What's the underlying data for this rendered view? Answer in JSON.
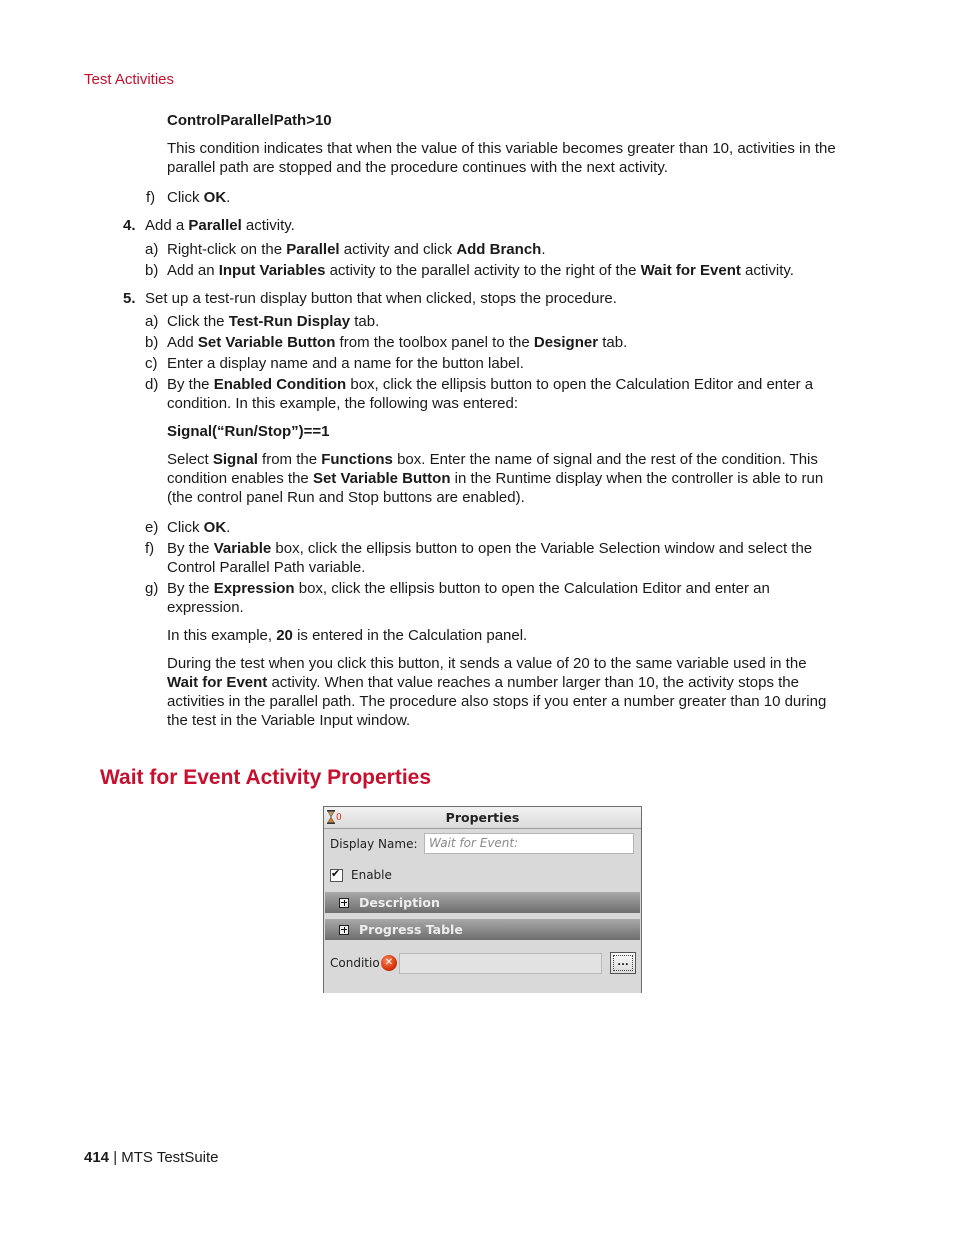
{
  "running_head": "Test Activities",
  "steps": {
    "condition_code": "ControlParallelPath>10",
    "condition_desc": "This condition indicates that when the value of this variable becomes greater than 10, activities in the parallel path are stopped and the procedure continues with the next activity.",
    "step3f": {
      "marker": "f)",
      "pre": "Click ",
      "bold": "OK",
      "post": "."
    },
    "step4": {
      "number": "4.",
      "pre": "Add a ",
      "bold": "Parallel",
      "post": " activity.",
      "a": {
        "marker": "a)",
        "t1": "Right-click on the ",
        "b1": "Parallel",
        "t2": " activity and click ",
        "b2": "Add Branch",
        "t3": "."
      },
      "b": {
        "marker": "b)",
        "t1": "Add an ",
        "b1": "Input Variables",
        "t2": " activity to the parallel activity to the right of the ",
        "b2": "Wait for Event",
        "t3": " activity."
      }
    },
    "step5": {
      "number": "5.",
      "text": "Set up a test-run display button that when clicked, stops the procedure.",
      "a": {
        "marker": "a)",
        "t1": "Click the ",
        "b1": "Test-Run Display",
        "t2": " tab."
      },
      "b": {
        "marker": "b)",
        "t1": "Add ",
        "b1": "Set Variable Button",
        "t2": " from the toolbox panel to the ",
        "b2": "Designer",
        "t3": " tab."
      },
      "c": {
        "marker": "c)",
        "text": "Enter a display name and a name for the button label."
      },
      "d": {
        "marker": "d)",
        "t1": "By the ",
        "b1": "Enabled Condition",
        "t2": " box, click the ellipsis button to open the Calculation Editor and enter a",
        "line2": "condition. In this example, the following was entered:"
      },
      "signal_code": "Signal(“Run/Stop”)==1",
      "signal_desc": {
        "t1": "Select ",
        "b1": "Signal",
        "t2": " from the ",
        "b2": "Functions",
        "t3": " box. Enter the name of signal and the rest of the condition. This",
        "l2a": "condition enables the ",
        "l2b": "Set Variable Button",
        "l2c": " in the Runtime display when the controller is able to run",
        "l3": "(the control panel Run and Stop buttons are enabled)."
      },
      "e": {
        "marker": "e)",
        "t1": "Click ",
        "b1": "OK",
        "t2": "."
      },
      "f": {
        "marker": "f)",
        "t1": "By the ",
        "b1": "Variable",
        "t2": " box, click the ellipsis button to open the Variable Selection window and select the",
        "line2": "Control Parallel Path variable."
      },
      "g": {
        "marker": "g)",
        "t1": "By the ",
        "b1": "Expression",
        "t2": " box, click the ellipsis button to open the Calculation Editor and enter an",
        "line2": "expression."
      },
      "example": {
        "t1": "In this example, ",
        "b1": "20",
        "t2": " is entered in the Calculation panel."
      },
      "during": {
        "l1": "During the test when you click this button, it sends a value of 20 to the same variable used in the",
        "l2b": "Wait for Event",
        "l2": " activity. When that value reaches a number larger than 10, the activity stops the",
        "l3": "activities in the parallel path. The procedure also stops if you enter a number greater than 10 during",
        "l4": "the test in the Variable Input window."
      }
    }
  },
  "section_title": "Wait for Event Activity Properties",
  "properties_panel": {
    "title": "Properties",
    "header_icon": "hourglass-icon",
    "display_name_label": "Display Name:",
    "display_name_placeholder": "Wait for Event:",
    "enable_label": "Enable",
    "enable_checked": true,
    "sections": [
      "Description",
      "Progress Table"
    ],
    "condition_label": "Conditio",
    "condition_value": "",
    "ellipsis_label": "..."
  },
  "footer": {
    "page_number": "414",
    "separator": " | ",
    "product": "MTS TestSuite"
  }
}
